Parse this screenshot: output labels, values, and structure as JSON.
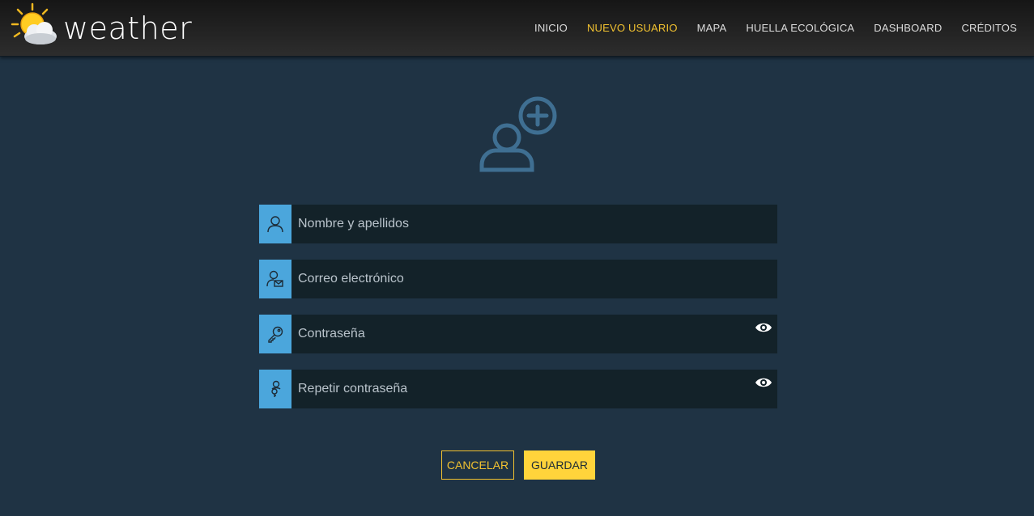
{
  "app": {
    "brand": "weather"
  },
  "nav": {
    "items": [
      {
        "label": "INICIO",
        "active": false
      },
      {
        "label": "NUEVO USUARIO",
        "active": true
      },
      {
        "label": "MAPA",
        "active": false
      },
      {
        "label": "HUELLA ECOLÓGICA",
        "active": false
      },
      {
        "label": "DASHBOARD",
        "active": false
      },
      {
        "label": "CRÉDITOS",
        "active": false
      }
    ]
  },
  "form": {
    "icon": "user-add-icon",
    "fields": [
      {
        "icon": "user-icon",
        "placeholder": "Nombre y apellidos",
        "value": ""
      },
      {
        "icon": "user-mail-icon",
        "placeholder": "Correo electrónico",
        "value": ""
      },
      {
        "icon": "key-icon",
        "placeholder": "Contraseña",
        "value": "",
        "toggle": "eye-icon"
      },
      {
        "icon": "user-key-icon",
        "placeholder": "Repetir contraseña",
        "value": "",
        "toggle": "eye-icon"
      }
    ],
    "cancel_label": "CANCELAR",
    "save_label": "GUARDAR"
  },
  "colors": {
    "background": "#1f3344",
    "accent_yellow": "#f2c230",
    "icon_blue": "#4ba6dc",
    "field_bg": "#132229"
  }
}
